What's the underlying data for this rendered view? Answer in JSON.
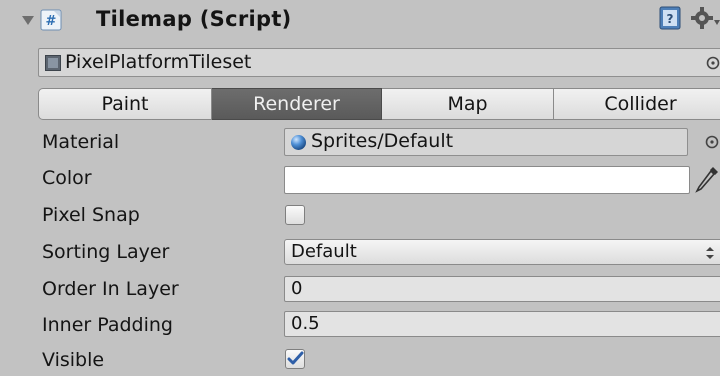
{
  "component": {
    "title": "Tilemap (Script)",
    "tileset": "PixelPlatformTileset"
  },
  "tabs": [
    {
      "label": "Paint",
      "active": false
    },
    {
      "label": "Renderer",
      "active": true
    },
    {
      "label": "Map",
      "active": false
    },
    {
      "label": "Collider",
      "active": false
    }
  ],
  "properties": {
    "material": {
      "label": "Material",
      "value": "Sprites/Default"
    },
    "color": {
      "label": "Color",
      "value": "#ffffff"
    },
    "pixel_snap": {
      "label": "Pixel Snap",
      "checked": false
    },
    "sorting_layer": {
      "label": "Sorting Layer",
      "value": "Default"
    },
    "order_in_layer": {
      "label": "Order In Layer",
      "value": "0"
    },
    "inner_padding": {
      "label": "Inner Padding",
      "value": "0.5"
    },
    "visible": {
      "label": "Visible",
      "checked": true
    }
  },
  "colors": {
    "panel_bg": "#c2c2c2",
    "active_tab": "#5f5f5f",
    "accent_blue": "#2f6fb3"
  },
  "icons": [
    "fold-arrow-icon",
    "script-icon",
    "help-icon",
    "gear-icon",
    "object-picker-icon",
    "eyedropper-icon",
    "material-sphere-icon",
    "checkmark-icon"
  ]
}
